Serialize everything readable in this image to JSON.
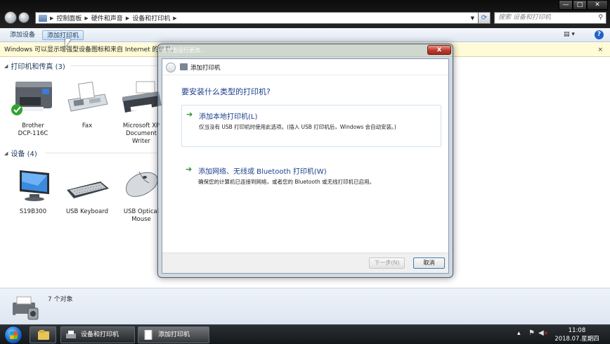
{
  "window": {
    "breadcrumb": [
      "控制面板",
      "硬件和声音",
      "设备和打印机"
    ],
    "search_placeholder": "搜索 设备和打印机",
    "controls": {
      "minimize": "—",
      "maximize": "□",
      "close": "✕"
    }
  },
  "toolbar": {
    "add_device": "添加设备",
    "add_printer": "添加打印机",
    "view_icon": "view-icon",
    "help": "?"
  },
  "infobar": {
    "text": "Windows 可以显示增强型设备图标和来自 Internet 的信息。",
    "close": "×"
  },
  "groups": {
    "printers": {
      "label": "打印机和传真 (3)",
      "items": [
        {
          "name_line1": "Brother",
          "name_line2": "DCP-116C",
          "default": true
        },
        {
          "name_line1": "Fax",
          "name_line2": ""
        },
        {
          "name_line1": "Microsoft XP",
          "name_line2": "Document",
          "name_line3": "Writer"
        }
      ]
    },
    "devices": {
      "label": "设备 (4)",
      "items": [
        {
          "name_line1": "S19B300",
          "name_line2": ""
        },
        {
          "name_line1": "USB Keyboard",
          "name_line2": ""
        },
        {
          "name_line1": "USB Optical",
          "name_line2": "Mouse"
        }
      ]
    }
  },
  "status": {
    "count": "7 个对象"
  },
  "dialog": {
    "window_title": "请单击运行更改...",
    "header_title": "添加打印机",
    "question": "要安装什么类型的打印机?",
    "option_local": {
      "title": "添加本地打印机(L)",
      "desc": "仅当没有 USB 打印机时使用此选项。(插入 USB 打印机后，Windows 会自动安装。)"
    },
    "option_network": {
      "title": "添加网络、无线或 Bluetooth 打印机(W)",
      "desc": "确保您的计算机已连接到网络，或者您的 Bluetooth 或无线打印机已启用。"
    },
    "next_button": "下一步(N)",
    "cancel_button": "取消",
    "close": "x"
  },
  "taskbar": {
    "tasks": [
      {
        "label": "设备和打印机"
      },
      {
        "label": "添加打印机"
      }
    ],
    "clock_time": "11:08",
    "clock_date": "2018.07.星期四"
  }
}
